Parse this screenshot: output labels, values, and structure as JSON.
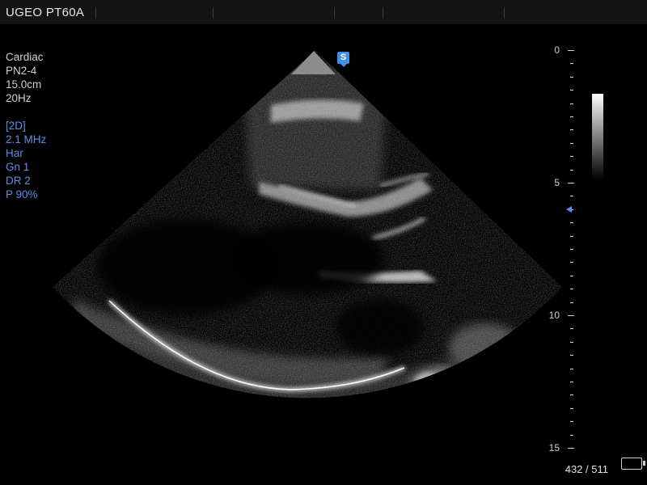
{
  "header": {
    "title": "UGEO PT60A"
  },
  "params": {
    "preset": "Cardiac",
    "probe": "PN2-4",
    "depth": "15.0cm",
    "frame_rate": "20Hz",
    "mode": "[2D]",
    "frequency": "2.1 MHz",
    "harmonic": "Har",
    "gain": "Gn 1",
    "dynamic_range": "DR 2",
    "power": "P 90%"
  },
  "scale": {
    "labels": [
      "0",
      "5",
      "10",
      "15"
    ]
  },
  "orientation_marker": {
    "label": "S"
  },
  "status": {
    "frame_counter": "432 / 511"
  },
  "icons": {
    "battery": "battery-icon",
    "focus": "focus-marker-icon",
    "orientation": "orientation-marker-icon"
  },
  "colors": {
    "param_blue": "#5b8fe8",
    "marker_blue": "#3f8ee8"
  }
}
